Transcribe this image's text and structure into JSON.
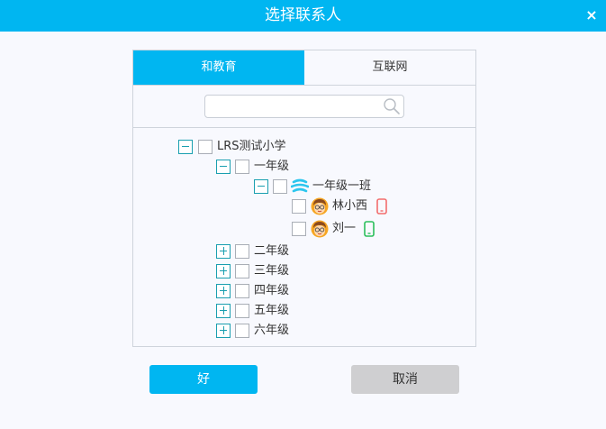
{
  "dialog": {
    "title": "选择联系人",
    "close_glyph": "×"
  },
  "tabs": [
    {
      "label": "和教育",
      "active": true
    },
    {
      "label": "互联网",
      "active": false
    }
  ],
  "search": {
    "value": "",
    "placeholder": ""
  },
  "tree": {
    "root": {
      "label": "LRS测试小学",
      "expanded": true
    },
    "grade1": {
      "label": "一年级",
      "expanded": true
    },
    "class1": {
      "label": "一年级一班",
      "expanded": true,
      "icon": "class-swirl-icon"
    },
    "members": [
      {
        "label": "林小西",
        "icon": "avatar-icon",
        "device": "phone-icon",
        "device_color": "#f26d6d"
      },
      {
        "label": "刘一",
        "icon": "avatar-icon",
        "device": "phone-icon",
        "device_color": "#2bbf5b"
      }
    ],
    "grades": [
      {
        "label": "二年级",
        "expanded": false
      },
      {
        "label": "三年级",
        "expanded": false
      },
      {
        "label": "四年级",
        "expanded": false
      },
      {
        "label": "五年级",
        "expanded": false
      },
      {
        "label": "六年级",
        "expanded": false
      }
    ]
  },
  "buttons": {
    "ok_label": "好",
    "cancel_label": "取消"
  },
  "colors": {
    "accent": "#00b6f1",
    "toggle_border": "#1a9fb0",
    "cancel_bg": "#cfcfd1",
    "background": "#f8f9fe"
  }
}
